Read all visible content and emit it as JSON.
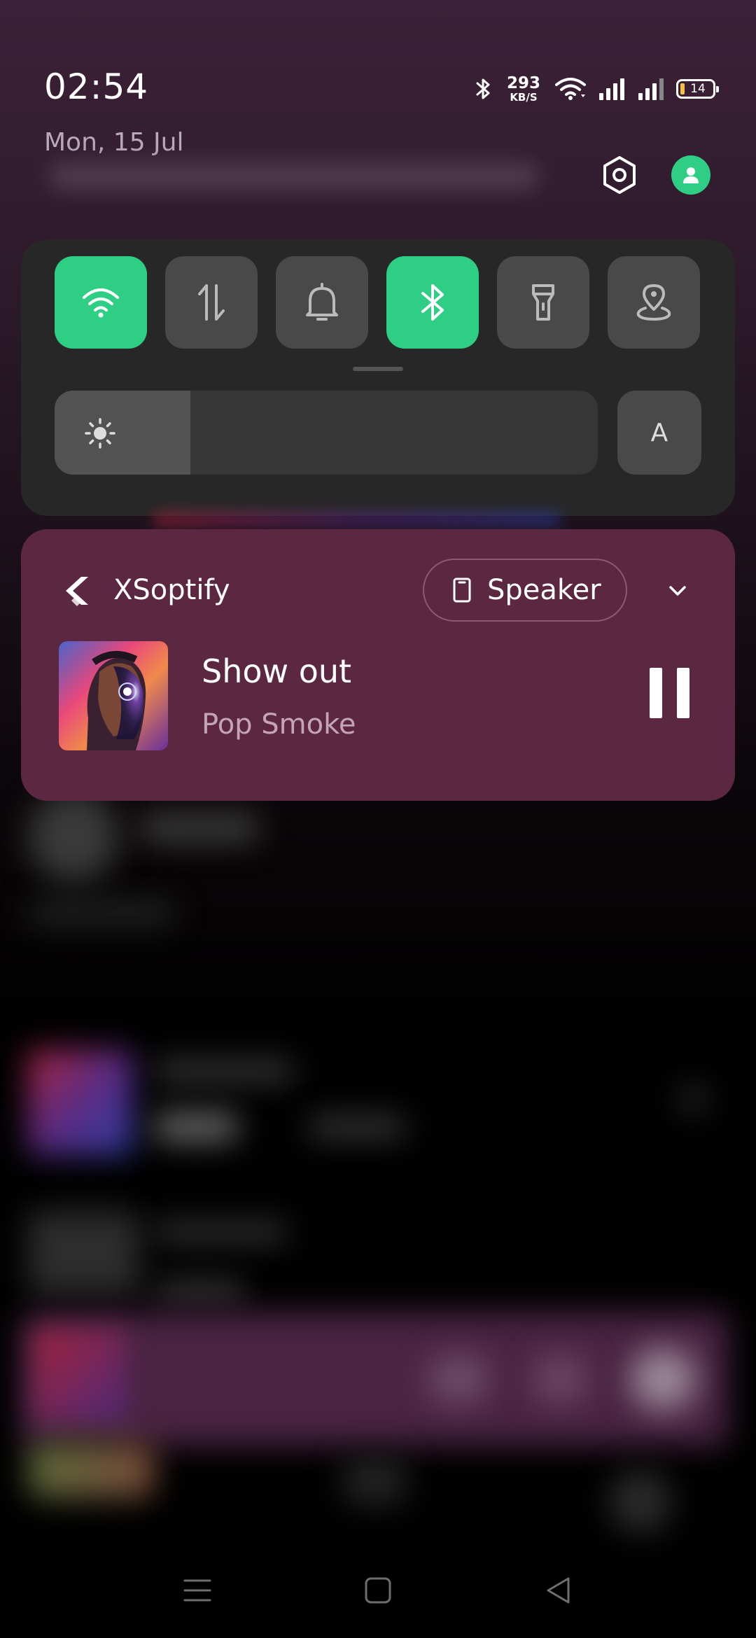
{
  "status_bar": {
    "time": "02:54",
    "net_speed_value": "293",
    "net_speed_unit": "KB/S",
    "battery_level": "14",
    "battery_fraction": 0.14
  },
  "header": {
    "date": "Mon, 15 Jul"
  },
  "quick_settings": {
    "tiles": [
      {
        "name": "wifi",
        "icon": "wifi-icon",
        "active": true
      },
      {
        "name": "mobile-data",
        "icon": "mobile-data-icon",
        "active": false
      },
      {
        "name": "sound",
        "icon": "bell-icon",
        "active": false
      },
      {
        "name": "bluetooth",
        "icon": "bluetooth-icon",
        "active": true
      },
      {
        "name": "flashlight",
        "icon": "flashlight-icon",
        "active": false
      },
      {
        "name": "location",
        "icon": "location-icon",
        "active": false
      }
    ],
    "brightness_level": 0.25,
    "auto_brightness_label": "A"
  },
  "media": {
    "app_name": "XSoptify",
    "output_label": "Speaker",
    "track_title": "Show out",
    "track_artist": "Pop Smoke"
  },
  "colors": {
    "accent_green": "#2ecf85",
    "media_card": "#5c2740",
    "panel": "#272727"
  }
}
